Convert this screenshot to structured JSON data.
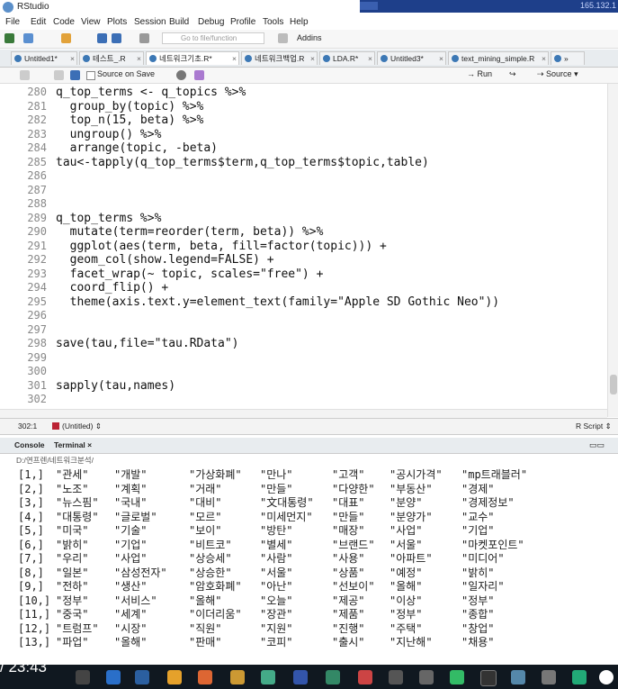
{
  "window": {
    "title": "RStudio",
    "ip_fragment": "165.132.1"
  },
  "menu": [
    "File",
    "Edit",
    "Code",
    "View",
    "Plots",
    "Session",
    "Build",
    "Debug",
    "Profile",
    "Tools",
    "Help"
  ],
  "toolbar": {
    "goto_placeholder": "Go to file/function",
    "addins_label": "Addins"
  },
  "tabs": [
    {
      "label": "Untitled1*"
    },
    {
      "label": "테스트_.R"
    },
    {
      "label": "네트워크기초.R*"
    },
    {
      "label": "네트워크백업.R"
    },
    {
      "label": "LDA.R*"
    },
    {
      "label": "Untitled3*"
    },
    {
      "label": "text_mining_simple.R"
    }
  ],
  "editor_toolbar": {
    "source_on_save": "Source on Save",
    "run_label": "Run",
    "source_label": "Source"
  },
  "code_lines": [
    {
      "n": "280",
      "text": "q_top_terms <- q_topics %>%"
    },
    {
      "n": "281",
      "text": "  group_by(topic) %>%"
    },
    {
      "n": "282",
      "text": "  top_n(15, beta) %>%"
    },
    {
      "n": "283",
      "text": "  ungroup() %>%"
    },
    {
      "n": "284",
      "text": "  arrange(topic, -beta)"
    },
    {
      "n": "285",
      "text": "tau<-tapply(q_top_terms$term,q_top_terms$topic,table)"
    },
    {
      "n": "286",
      "text": ""
    },
    {
      "n": "287",
      "text": ""
    },
    {
      "n": "288",
      "text": ""
    },
    {
      "n": "289",
      "text": "q_top_terms %>%"
    },
    {
      "n": "290",
      "text": "  mutate(term=reorder(term, beta)) %>%"
    },
    {
      "n": "291",
      "text": "  ggplot(aes(term, beta, fill=factor(topic))) +"
    },
    {
      "n": "292",
      "text": "  geom_col(show.legend=FALSE) +"
    },
    {
      "n": "293",
      "text": "  facet_wrap(~ topic, scales=\"free\") +"
    },
    {
      "n": "294",
      "text": "  coord_flip() +"
    },
    {
      "n": "295",
      "text": "  theme(axis.text.y=element_text(family=\"Apple SD Gothic Neo\"))"
    },
    {
      "n": "296",
      "text": ""
    },
    {
      "n": "297",
      "text": ""
    },
    {
      "n": "298",
      "text": "save(tau,file=\"tau.RData\")"
    },
    {
      "n": "299",
      "text": ""
    },
    {
      "n": "300",
      "text": ""
    },
    {
      "n": "301",
      "text": "sapply(tau,names)"
    },
    {
      "n": "302",
      "text": ""
    }
  ],
  "status": {
    "position": "302:1",
    "scope": "(Untitled)",
    "filetype": "R Script"
  },
  "console": {
    "tab_console": "Console",
    "tab_terminal": "Terminal",
    "path": "D:/연프렌/네트워크분석/",
    "rows": [
      [
        "[1,]",
        "\"관세\"",
        "\"개발\"",
        "\"가상화폐\"",
        "\"만나\"",
        "\"고객\"",
        "\"공시가격\"",
        "\"mp트래블러\""
      ],
      [
        "[2,]",
        "\"노조\"",
        "\"계획\"",
        "\"거래\"",
        "\"만들\"",
        "\"다양한\"",
        "\"부동산\"",
        "\"경제\""
      ],
      [
        "[3,]",
        "\"뉴스핌\"",
        "\"국내\"",
        "\"대비\"",
        "\"文대통령\"",
        "\"대표\"",
        "\"분양\"",
        "\"경제정보\""
      ],
      [
        "[4,]",
        "\"대통령\"",
        "\"글로벌\"",
        "\"모르\"",
        "\"미세먼지\"",
        "\"만들\"",
        "\"분양가\"",
        "\"교수\""
      ],
      [
        "[5,]",
        "\"미국\"",
        "\"기술\"",
        "\"보이\"",
        "\"방탄\"",
        "\"매장\"",
        "\"사업\"",
        "\"기업\""
      ],
      [
        "[6,]",
        "\"밝히\"",
        "\"기업\"",
        "\"비트코\"",
        "\"별세\"",
        "\"브랜드\"",
        "\"서울\"",
        "\"마켓포인트\""
      ],
      [
        "[7,]",
        "\"우리\"",
        "\"사업\"",
        "\"상승세\"",
        "\"사람\"",
        "\"사용\"",
        "\"아파트\"",
        "\"미디어\""
      ],
      [
        "[8,]",
        "\"일본\"",
        "\"삼성전자\"",
        "\"상승한\"",
        "\"서울\"",
        "\"상품\"",
        "\"예정\"",
        "\"밝히\""
      ],
      [
        "[9,]",
        "\"전하\"",
        "\"생산\"",
        "\"암호화폐\"",
        "\"아난\"",
        "\"선보이\"",
        "\"올해\"",
        "\"일자리\""
      ],
      [
        "[10,]",
        "\"정부\"",
        "\"서비스\"",
        "\"올해\"",
        "\"오늘\"",
        "\"제공\"",
        "\"이상\"",
        "\"정부\""
      ],
      [
        "[11,]",
        "\"중국\"",
        "\"세계\"",
        "\"이더리움\"",
        "\"장관\"",
        "\"제품\"",
        "\"정부\"",
        "\"종합\""
      ],
      [
        "[12,]",
        "\"트럼프\"",
        "\"시장\"",
        "\"직원\"",
        "\"지원\"",
        "\"진행\"",
        "\"주택\"",
        "\"창업\""
      ],
      [
        "[13,]",
        "\"파업\"",
        "\"올해\"",
        "\"판매\"",
        "\"코피\"",
        "\"출시\"",
        "\"지난해\"",
        "\"채용\""
      ]
    ]
  },
  "video": {
    "time_label": "/ 23:43"
  },
  "colors": {
    "editor_bg": "#ffffff",
    "taskbar_bg": "#101820",
    "titlebar_accent": "#1e3f8a"
  }
}
